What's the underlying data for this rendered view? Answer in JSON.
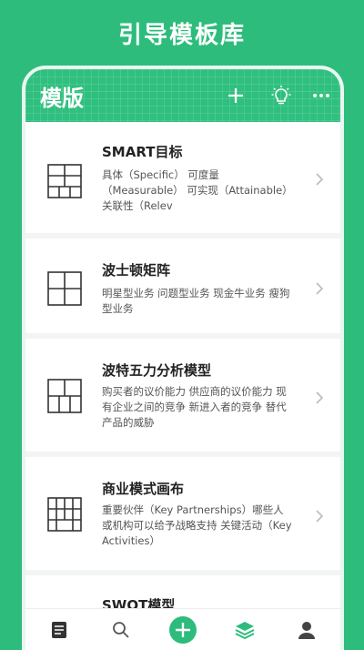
{
  "promo": {
    "title": "引导模板库"
  },
  "header": {
    "title": "模版",
    "actions": [
      "add-icon",
      "bulb-icon",
      "more-icon"
    ]
  },
  "templates": [
    {
      "name": "SMART目标",
      "desc": "具体（Specific） 可度量（Measurable） 可实现（Attainable） 关联性（Relev",
      "icon": "grid-2x3-icon"
    },
    {
      "name": "波士顿矩阵",
      "desc": "明星型业务 问题型业务 现金牛业务 瘦狗型业务",
      "icon": "grid-2x2-icon"
    },
    {
      "name": "波特五力分析模型",
      "desc": "购买者的议价能力 供应商的议价能力 现有企业之间的竞争 新进入者的竞争 替代产品的威胁",
      "icon": "grid-5-icon"
    },
    {
      "name": "商业模式画布",
      "desc": "重要伙伴（Key Partnerships）哪些人或机构可以给予战略支持 关键活动（Key Activities）",
      "icon": "grid-9-icon"
    },
    {
      "name": "SWOT模型",
      "desc": "",
      "icon": "grid-2x2-icon"
    }
  ],
  "tabbar": {
    "items": [
      "templates-tab",
      "search-tab",
      "create-tab",
      "library-tab",
      "profile-tab"
    ],
    "active": "library-tab",
    "accent": "#2dbc7c"
  }
}
